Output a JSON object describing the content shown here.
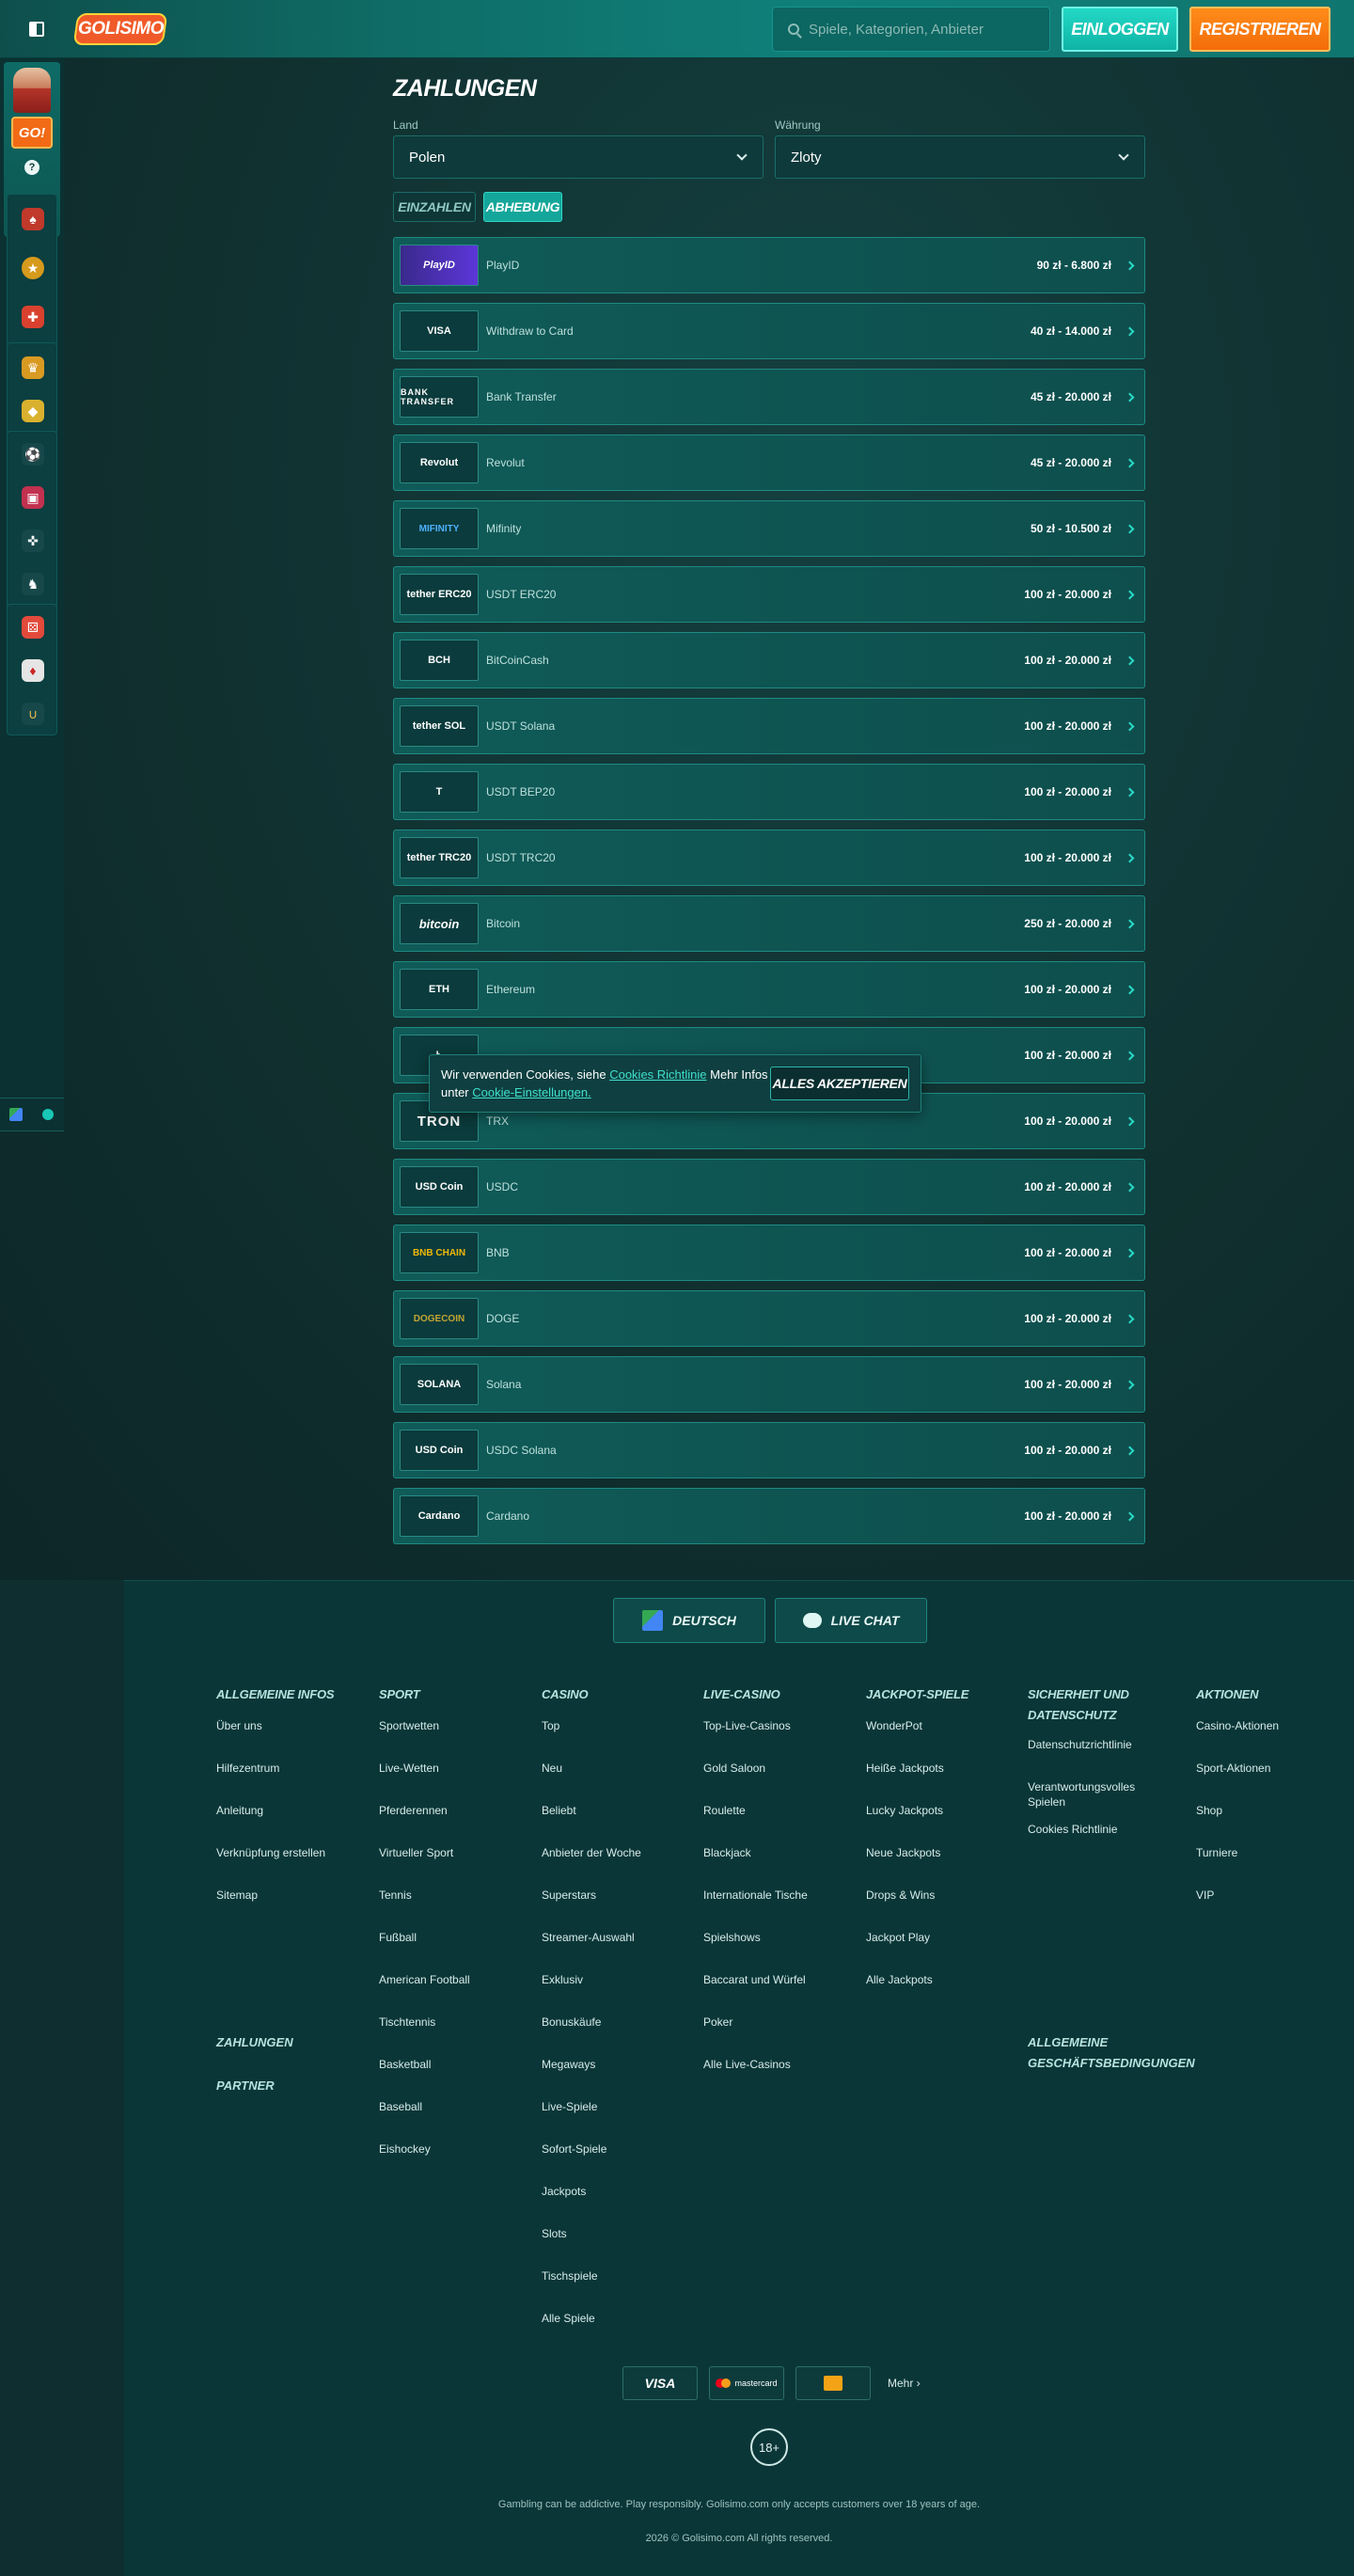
{
  "header": {
    "logo": "GOLISIMO",
    "search_placeholder": "Spiele, Kategorien, Anbieter",
    "login": "EINLOGGEN",
    "register": "REGISTRIEREN"
  },
  "sidebar": {
    "promo_label": "GO!",
    "help": "?",
    "icons": [
      "cards-icon",
      "coin-icon",
      "gift-icon",
      "trophy-icon",
      "shield-icon",
      "football-icon",
      "live-dealer-icon",
      "gamepad-icon",
      "horse-icon",
      "dice-icon",
      "card-icon",
      "horseshoe-icon"
    ]
  },
  "page": {
    "title": "ZAHLUNGEN",
    "country_label": "Land",
    "country_value": "Polen",
    "currency_label": "Währung",
    "currency_value": "Zloty",
    "tab_deposit": "EINZAHLEN",
    "tab_withdraw": "ABHEBUNG"
  },
  "methods": [
    {
      "logo": "PlayID",
      "name": "PlayID",
      "range": "90 zł - 6.800 zł"
    },
    {
      "logo": "VISA",
      "name": "Withdraw to Card",
      "range": "40 zł - 14.000 zł"
    },
    {
      "logo": "BANK TRANSFER",
      "name": "Bank Transfer",
      "range": "45 zł - 20.000 zł"
    },
    {
      "logo": "Revolut",
      "name": "Revolut",
      "range": "45 zł - 20.000 zł"
    },
    {
      "logo": "MIFINITY",
      "name": "Mifinity",
      "range": "50 zł - 10.500 zł"
    },
    {
      "logo": "tether ERC20",
      "name": "USDT ERC20",
      "range": "100 zł - 20.000 zł"
    },
    {
      "logo": "BCH",
      "name": "BitCoinCash",
      "range": "100 zł - 20.000 zł"
    },
    {
      "logo": "tether SOL",
      "name": "USDT Solana",
      "range": "100 zł - 20.000 zł"
    },
    {
      "logo": "T",
      "name": "USDT BEP20",
      "range": "100 zł - 20.000 zł"
    },
    {
      "logo": "tether TRC20",
      "name": "USDT TRC20",
      "range": "100 zł - 20.000 zł"
    },
    {
      "logo": "bitcoin",
      "name": "Bitcoin",
      "range": "250 zł - 20.000 zł"
    },
    {
      "logo": "ETH",
      "name": "Ethereum",
      "range": "100 zł - 20.000 zł"
    },
    {
      "logo": "Ł",
      "name": "",
      "range": "100 zł - 20.000 zł"
    },
    {
      "logo": "TRON",
      "name": "TRX",
      "range": "100 zł - 20.000 zł"
    },
    {
      "logo": "USD Coin",
      "name": "USDC",
      "range": "100 zł - 20.000 zł"
    },
    {
      "logo": "BNB CHAIN",
      "name": "BNB",
      "range": "100 zł - 20.000 zł"
    },
    {
      "logo": "DOGECOIN",
      "name": "DOGE",
      "range": "100 zł - 20.000 zł"
    },
    {
      "logo": "SOLANA",
      "name": "Solana",
      "range": "100 zł - 20.000 zł"
    },
    {
      "logo": "USD Coin",
      "name": "USDC Solana",
      "range": "100 zł - 20.000 zł"
    },
    {
      "logo": "Cardano",
      "name": "Cardano",
      "range": "100 zł - 20.000 zł"
    }
  ],
  "cookie": {
    "text_a": "Wir verwenden Cookies, siehe ",
    "link1": "Cookies Richtlinie",
    "text_b": " Mehr Infos unter ",
    "link2": "Cookie-Einstellungen.",
    "button": "ALLES AKZEPTIEREN"
  },
  "footer": {
    "lang_button": "DEUTSCH",
    "chat_button": "LIVE CHAT",
    "columns": [
      {
        "head": "ALLGEMEINE INFOS",
        "links": [
          "Über uns",
          "Hilfezentrum",
          "Anleitung",
          "Verknüpfung erstellen",
          "Sitemap"
        ]
      },
      {
        "head": "SPORT",
        "links": [
          "Sportwetten",
          "Live-Wetten",
          "Pferderennen",
          "Virtueller Sport",
          "Tennis",
          "Fußball",
          "American Football",
          "Tischtennis",
          "Basketball",
          "Baseball",
          "Eishockey"
        ]
      },
      {
        "head": "CASINO",
        "links": [
          "Top",
          "Neu",
          "Beliebt",
          "Anbieter der Woche",
          "Superstars",
          "Streamer-Auswahl",
          "Exklusiv",
          "Bonuskäufe",
          "Megaways",
          "Live-Spiele",
          "Sofort-Spiele",
          "Jackpots",
          "Slots",
          "Tischspiele",
          "Alle Spiele"
        ]
      },
      {
        "head": "LIVE-CASINO",
        "links": [
          "Top-Live-Casinos",
          "Gold Saloon",
          "Roulette",
          "Blackjack",
          "Internationale Tische",
          "Spielshows",
          "Baccarat und Würfel",
          "Poker",
          "Alle Live-Casinos"
        ]
      },
      {
        "head": "JACKPOT-SPIELE",
        "links": [
          "WonderPot",
          "Heiße Jackpots",
          "Lucky Jackpots",
          "Neue Jackpots",
          "Drops & Wins",
          "Jackpot Play",
          "Alle Jackpots"
        ]
      },
      {
        "head": "SICHERHEIT UND DATENSCHUTZ",
        "links": [
          "Datenschutzrichtlinie",
          "Verantwortungsvolles Spielen",
          "Cookies Richtlinie"
        ]
      },
      {
        "head": "AKTIONEN",
        "links": [
          "Casino-Aktionen",
          "Sport-Aktionen",
          "Shop",
          "Turniere",
          "VIP"
        ]
      }
    ],
    "payments_head": "ZAHLUNGEN",
    "partner_head": "PARTNER",
    "terms_head": "ALLGEMEINE GESCHÄFTSBEDINGUNGEN",
    "pay_visa": "VISA",
    "pay_mastercard": "mastercard",
    "more": "Mehr",
    "age": "18+",
    "disclaimer": "Gambling can be addictive. Play responsibly. Golisimo.com only accepts customers over 18 years of age.",
    "copyright": "2026 © Golisimo.com All rights reserved."
  }
}
